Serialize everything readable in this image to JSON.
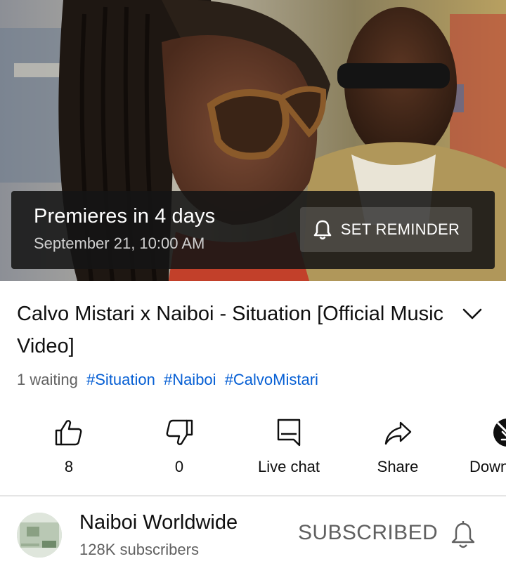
{
  "video": {
    "premiere_title": "Premieres in 4 days",
    "premiere_date": "September 21, 10:00 AM",
    "reminder_label": "SET REMINDER"
  },
  "title": "Calvo Mistari x Naiboi - Situation [Official Music Video]",
  "meta": {
    "waiting": "1 waiting",
    "hashtags": [
      "#Situation",
      "#Naiboi",
      "#CalvoMistari"
    ]
  },
  "actions": [
    {
      "icon": "thumbs-up-icon",
      "label": "8"
    },
    {
      "icon": "thumbs-down-icon",
      "label": "0"
    },
    {
      "icon": "live-chat-icon",
      "label": "Live chat"
    },
    {
      "icon": "share-icon",
      "label": "Share"
    },
    {
      "icon": "download-icon",
      "label": "Down"
    }
  ],
  "channel": {
    "name": "Naiboi Worldwide",
    "subscribers": "128K subscribers",
    "subscribe_label": "SUBSCRIBED"
  },
  "colors": {
    "link": "#065fd4",
    "secondary_text": "#606060",
    "premiere_overlay": "#141414"
  }
}
